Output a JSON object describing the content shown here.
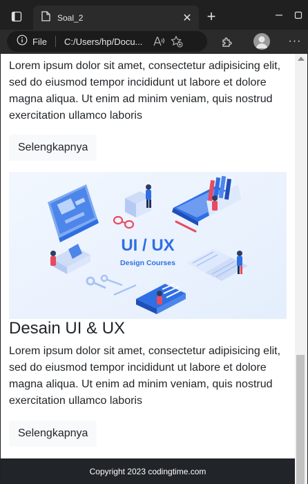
{
  "browser": {
    "tab_title": "Soal_2",
    "address_scheme": "File",
    "address_url": "C:/Users/hp/Docu..."
  },
  "page": {
    "paragraph": "Lorem ipsum dolor sit amet, consectetur adipisicing elit, sed do eiusmod tempor incididunt ut labore et dolore magna aliqua. Ut enim ad minim veniam, quis nostrud exercitation ullamco laboris",
    "more_label": "Selengkapnya",
    "card_title": "Desain UI & UX",
    "hero": {
      "heading": "UI / UX",
      "subheading": "Design Courses"
    },
    "footer": "Copyright 2023 codingtime.com"
  },
  "colors": {
    "accent_blue": "#2f6fe4",
    "footer_bg": "#212529",
    "button_bg": "#f8f9fa"
  }
}
